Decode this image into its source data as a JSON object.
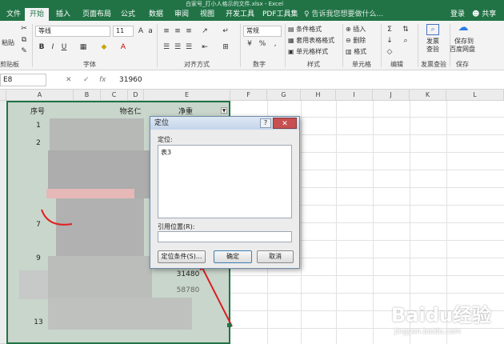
{
  "window": {
    "title": "白家号_打小人格示的文件.xlsx - Excel"
  },
  "tabs": [
    "文件",
    "开始",
    "插入",
    "页面布局",
    "公式",
    "数据",
    "审阅",
    "视图",
    "开发工具",
    "PDF工具集"
  ],
  "tell_me": "告诉我您想要做什么...",
  "signin": "登录",
  "share": "共享",
  "ribbon": {
    "clipboard_label": "剪贴板",
    "paste_label": "粘贴",
    "font_name": "等线",
    "font_size": "11",
    "font_group": "字体",
    "bold": "B",
    "italic": "I",
    "underline": "U",
    "align_group": "对齐方式",
    "number_format": "常规",
    "number_group": "数字",
    "percent": "%",
    "cond_format": "条件格式",
    "table_format": "套用表格格式",
    "cell_style": "单元格样式",
    "style_group": "样式",
    "insert": "插入",
    "delete": "删除",
    "format": "格式",
    "cells_group": "单元格",
    "edit_group": "编辑",
    "publish_check": "发票查验",
    "publish_line1": "发票",
    "publish_line2": "查验",
    "save_baidu_line1": "保存到",
    "save_baidu_line2": "百度网盘",
    "save_group": "保存"
  },
  "formula_bar": {
    "name_box": "E8",
    "fx": "fx",
    "value": "31960"
  },
  "columns": [
    "A",
    "B",
    "C",
    "D",
    "E",
    "F",
    "G",
    "H",
    "I",
    "J",
    "K",
    "L"
  ],
  "table": {
    "header_a": "序号",
    "header_d": "物名仁",
    "header_e": "净重",
    "row_values": [
      "1",
      "2",
      "",
      "",
      "",
      "",
      "7",
      "",
      "9",
      "",
      "",
      "13"
    ],
    "e_values": [
      "31480",
      "58780"
    ]
  },
  "dialog": {
    "title": "定位",
    "help": "?",
    "close": "✕",
    "goto_label": "定位:",
    "list_items": [
      "表3"
    ],
    "ref_label": "引用位置(R):",
    "ref_value": "",
    "special_button": "定位条件(S)...",
    "ok_button": "确定",
    "cancel_button": "取消"
  },
  "watermark": {
    "main": "Baidu经验",
    "sub": "jingyan.baidu.com"
  },
  "colors": {
    "excel_green": "#217346",
    "arrow_red": "#e02020"
  }
}
